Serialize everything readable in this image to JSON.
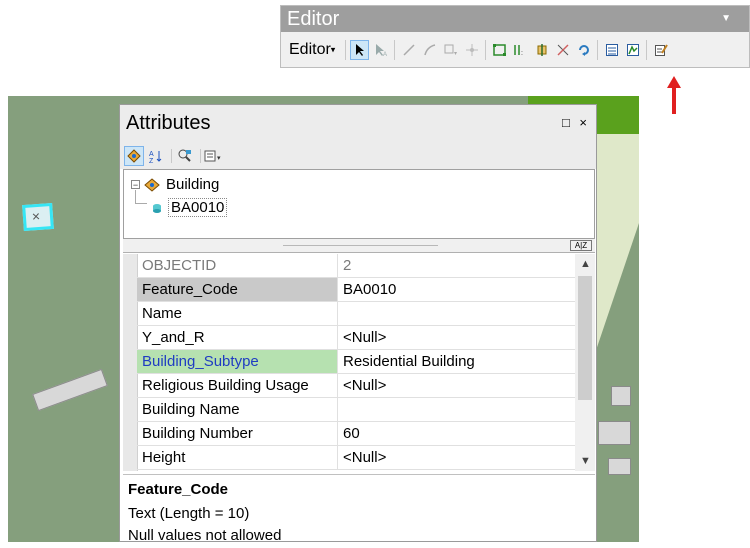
{
  "editor": {
    "title": "Editor",
    "menu_label": "Editor",
    "menu_arrow": "▾"
  },
  "attributes": {
    "title": "Attributes",
    "window_controls": "□ ×",
    "tree": {
      "layer": "Building",
      "feature": "BA0010",
      "expander": "−"
    },
    "rows": [
      {
        "field": "OBJECTID",
        "value": "2",
        "state": "readonly"
      },
      {
        "field": "Feature_Code",
        "value": "BA0010",
        "state": "selected"
      },
      {
        "field": "Name",
        "value": "",
        "state": "normal"
      },
      {
        "field": "Y_and_R",
        "value": "<Null>",
        "state": "normal"
      },
      {
        "field": "Building_Subtype",
        "value": "Residential Building",
        "state": "subtype"
      },
      {
        "field": "Religious Building Usage",
        "value": "<Null>",
        "state": "normal"
      },
      {
        "field": "Building Name",
        "value": "",
        "state": "normal"
      },
      {
        "field": "Building Number",
        "value": "60",
        "state": "normal"
      },
      {
        "field": "Height",
        "value": "<Null>",
        "state": "normal"
      }
    ],
    "description": {
      "title": "Feature_Code",
      "type": "Text (Length = 10)",
      "note": "Null values not allowed"
    }
  },
  "colors": {
    "map_bg": "#859f7d",
    "selection": "#35e6f5",
    "subtype_bg": "#b6e1b0",
    "subtype_text": "#1f3cc2",
    "selected_bg": "#c9c9c9",
    "arrow": "#e02020"
  }
}
